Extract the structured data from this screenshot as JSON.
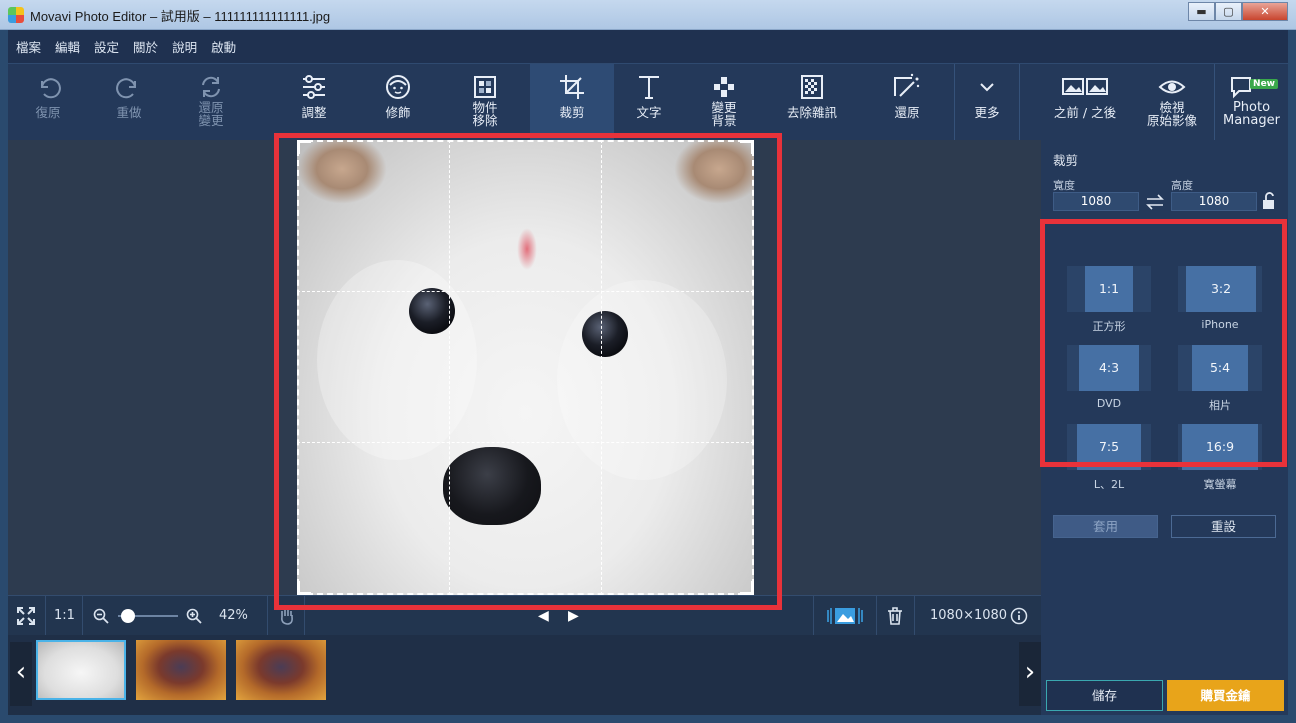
{
  "window": {
    "title": "Movavi Photo Editor – 試用版 – 111111111111111.jpg",
    "minimize": "▬",
    "maximize": "▢",
    "close": "✕"
  },
  "menu": [
    "檔案",
    "編輯",
    "設定",
    "關於",
    "說明",
    "啟動"
  ],
  "toolbar": {
    "undo": "復原",
    "redo": "重做",
    "restore_line1": "還原",
    "restore_line2": "變更",
    "adjust": "調整",
    "retouch": "修飾",
    "object_line1": "物件",
    "object_line2": "移除",
    "crop": "裁剪",
    "text": "文字",
    "bg_line1": "變更",
    "bg_line2": "背景",
    "denoise": "去除雜訊",
    "restore": "還原",
    "more": "更多",
    "before_after": "之前 / 之後",
    "view_line1": "檢視",
    "view_line2": "原始影像",
    "pm_line1": "Photo",
    "pm_line2": "Manager",
    "new_badge": "New"
  },
  "status": {
    "zoom_reset": "1:1",
    "zoom_percent": "42%",
    "image_size": "1080×1080",
    "zoom_slider_fraction": 0.05
  },
  "panel": {
    "title": "裁剪",
    "width_label": "寬度",
    "height_label": "高度",
    "width_value": "1080",
    "height_value": "1080",
    "ratios": [
      {
        "ratio": "1:1",
        "label": "正方形"
      },
      {
        "ratio": "3:2",
        "label": "iPhone"
      },
      {
        "ratio": "4:3",
        "label": "DVD"
      },
      {
        "ratio": "5:4",
        "label": "相片"
      },
      {
        "ratio": "7:5",
        "label": "L、2L"
      },
      {
        "ratio": "16:9",
        "label": "寬螢幕"
      }
    ],
    "apply": "套用",
    "reset": "重設"
  },
  "footer": {
    "save": "儲存",
    "buy": "購買金鑰"
  },
  "colors": {
    "highlight": "#e8323a",
    "accent_buy": "#e8a41a",
    "ratio_fill": "#4670a4"
  }
}
